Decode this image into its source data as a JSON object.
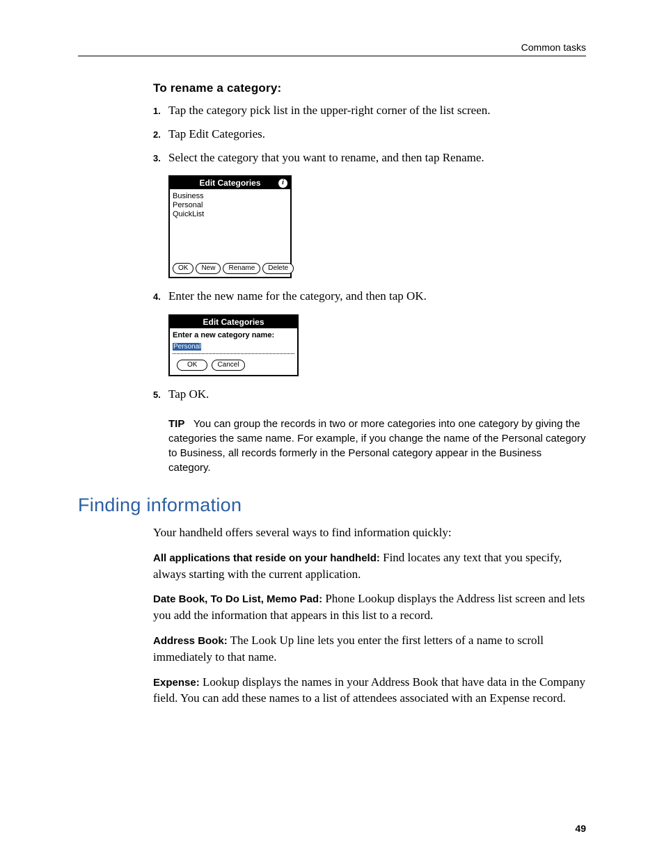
{
  "header": {
    "right": "Common tasks"
  },
  "subhead": "To rename a category:",
  "steps": {
    "s1": {
      "n": "1.",
      "text": "Tap the category pick list in the upper-right corner of the list screen."
    },
    "s2": {
      "n": "2.",
      "text": "Tap Edit Categories."
    },
    "s3": {
      "n": "3.",
      "text": "Select the category that you want to rename, and then tap Rename."
    },
    "s4": {
      "n": "4.",
      "text": "Enter the new name for the category, and then tap OK."
    },
    "s5": {
      "n": "5.",
      "text": "Tap OK."
    }
  },
  "shot1": {
    "title": "Edit Categories",
    "info_glyph": "i",
    "items": [
      "Business",
      "Personal",
      "QuickList"
    ],
    "buttons": {
      "ok": "OK",
      "new": "New",
      "rename": "Rename",
      "delete": "Delete"
    }
  },
  "shot2": {
    "title": "Edit Categories",
    "prompt": "Enter a new category name:",
    "value": "Personal",
    "buttons": {
      "ok": "OK",
      "cancel": "Cancel"
    }
  },
  "tip": {
    "label": "TIP",
    "text": "You can group the records in two or more categories into one category by giving the categories the same name. For example, if you change the name of the Personal category to Business, all records formerly in the Personal category appear in the Business category."
  },
  "section_heading": "Finding information",
  "intro": "Your handheld offers several ways to find information quickly:",
  "defs": {
    "d1": {
      "term": "All applications that reside on your handheld:",
      "text": " Find locates any text that you specify, always starting with the current application."
    },
    "d2": {
      "term": "Date Book, To Do List, Memo Pad:",
      "text": " Phone Lookup displays the Address list screen and lets you add the information that appears in this list to a record."
    },
    "d3": {
      "term": "Address Book:",
      "text": " The Look Up line lets you enter the first letters of a name to scroll immediately to that name."
    },
    "d4": {
      "term": "Expense:",
      "text": " Lookup displays the names in your Address Book that have data in the Company field. You can add these names to a list of attendees associated with an Expense record."
    }
  },
  "page_number": "49"
}
